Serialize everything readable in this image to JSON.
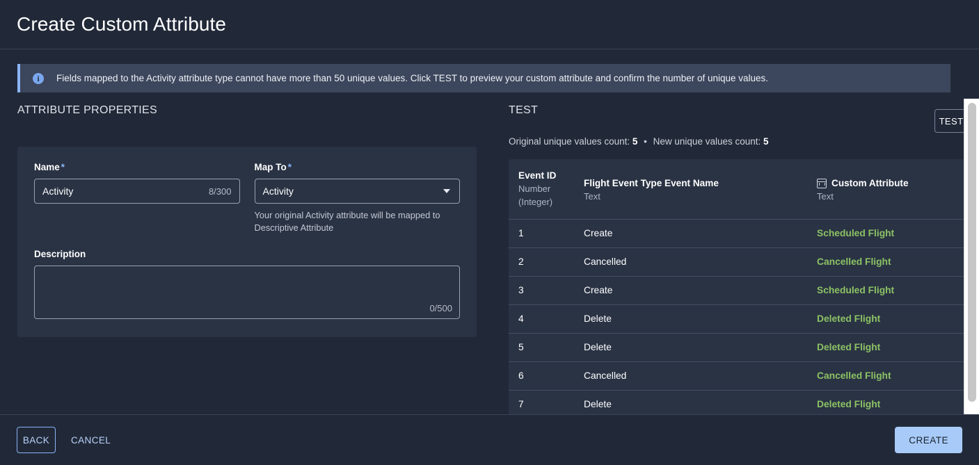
{
  "window": {
    "title": "Create Custom Attribute"
  },
  "banner": {
    "icon": "info-circle-icon",
    "text": "Fields mapped to the Activity attribute type cannot have more than 50 unique values. Click TEST to preview your custom attribute and confirm the number of unique values."
  },
  "attribute_properties": {
    "section_title": "ATTRIBUTE PROPERTIES",
    "name": {
      "label": "Name",
      "required_marker": "*",
      "value": "Activity",
      "placeholder": "",
      "counter": "8/300"
    },
    "map_to": {
      "label": "Map To",
      "required_marker": "*",
      "value": "Activity",
      "caret_icon": "chevron-down-icon",
      "helper_text": "Your original Activity attribute will be mapped to Descriptive Attribute"
    },
    "description": {
      "label": "Description",
      "value": "",
      "placeholder": "",
      "counter": "0/500"
    }
  },
  "test": {
    "section_title": "TEST",
    "test_button": "TEST",
    "counts_prefix": "Original unique values count:",
    "original_count": "5",
    "separator": "•",
    "new_prefix": "New unique values count:",
    "new_count": "5",
    "table": {
      "columns": [
        {
          "name": "Event ID",
          "type": "Number",
          "type2": "(Integer)",
          "icon": ""
        },
        {
          "name": "Flight Event Type Event Name",
          "type": "Text",
          "type2": "",
          "icon": ""
        },
        {
          "name": "Custom Attribute",
          "type": "Text",
          "type2": "",
          "icon": "table-grid-icon"
        }
      ],
      "rows": [
        {
          "event_id": "1",
          "event_name": "Create",
          "custom_attribute": "Scheduled Flight"
        },
        {
          "event_id": "2",
          "event_name": "Cancelled",
          "custom_attribute": "Cancelled Flight"
        },
        {
          "event_id": "3",
          "event_name": "Create",
          "custom_attribute": "Scheduled Flight"
        },
        {
          "event_id": "4",
          "event_name": "Delete",
          "custom_attribute": "Deleted Flight"
        },
        {
          "event_id": "5",
          "event_name": "Delete",
          "custom_attribute": "Deleted Flight"
        },
        {
          "event_id": "6",
          "event_name": "Cancelled",
          "custom_attribute": "Cancelled Flight"
        },
        {
          "event_id": "7",
          "event_name": "Delete",
          "custom_attribute": "Deleted Flight"
        }
      ]
    }
  },
  "footer": {
    "back": "BACK",
    "cancel": "CANCEL",
    "create": "CREATE"
  },
  "colors": {
    "page_bg": "#212938",
    "panel_bg": "#2a3344",
    "banner_bg": "#3c465c",
    "accent_blue": "#8bb4f7",
    "primary_button_bg": "#a8caf8",
    "value_green": "#8cc264"
  }
}
